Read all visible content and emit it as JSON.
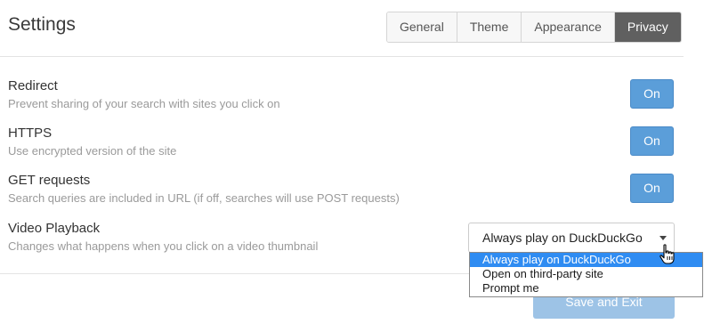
{
  "header": {
    "title": "Settings",
    "tabs": [
      {
        "label": "General",
        "active": false
      },
      {
        "label": "Theme",
        "active": false
      },
      {
        "label": "Appearance",
        "active": false
      },
      {
        "label": "Privacy",
        "active": true
      }
    ]
  },
  "settings": [
    {
      "label": "Redirect",
      "description": "Prevent sharing of your search with sites you click on",
      "value": "On"
    },
    {
      "label": "HTTPS",
      "description": "Use encrypted version of the site",
      "value": "On"
    },
    {
      "label": "GET requests",
      "description": "Search queries are included in URL (if off, searches will use POST requests)",
      "value": "On"
    }
  ],
  "video_playback": {
    "label": "Video Playback",
    "description": "Changes what happens when you click on a video thumbnail",
    "selected": "Always play on DuckDuckGo",
    "options": [
      "Always play on DuckDuckGo",
      "Open on third-party site",
      "Prompt me"
    ],
    "highlighted_option": "Always play on DuckDuckGo"
  },
  "footer": {
    "save_label": "Save and Exit"
  },
  "colors": {
    "toggle_blue": "#5b9ed9",
    "active_tab": "#606060",
    "save_button": "#9dc3e6",
    "option_highlight": "#2f8cf2"
  }
}
